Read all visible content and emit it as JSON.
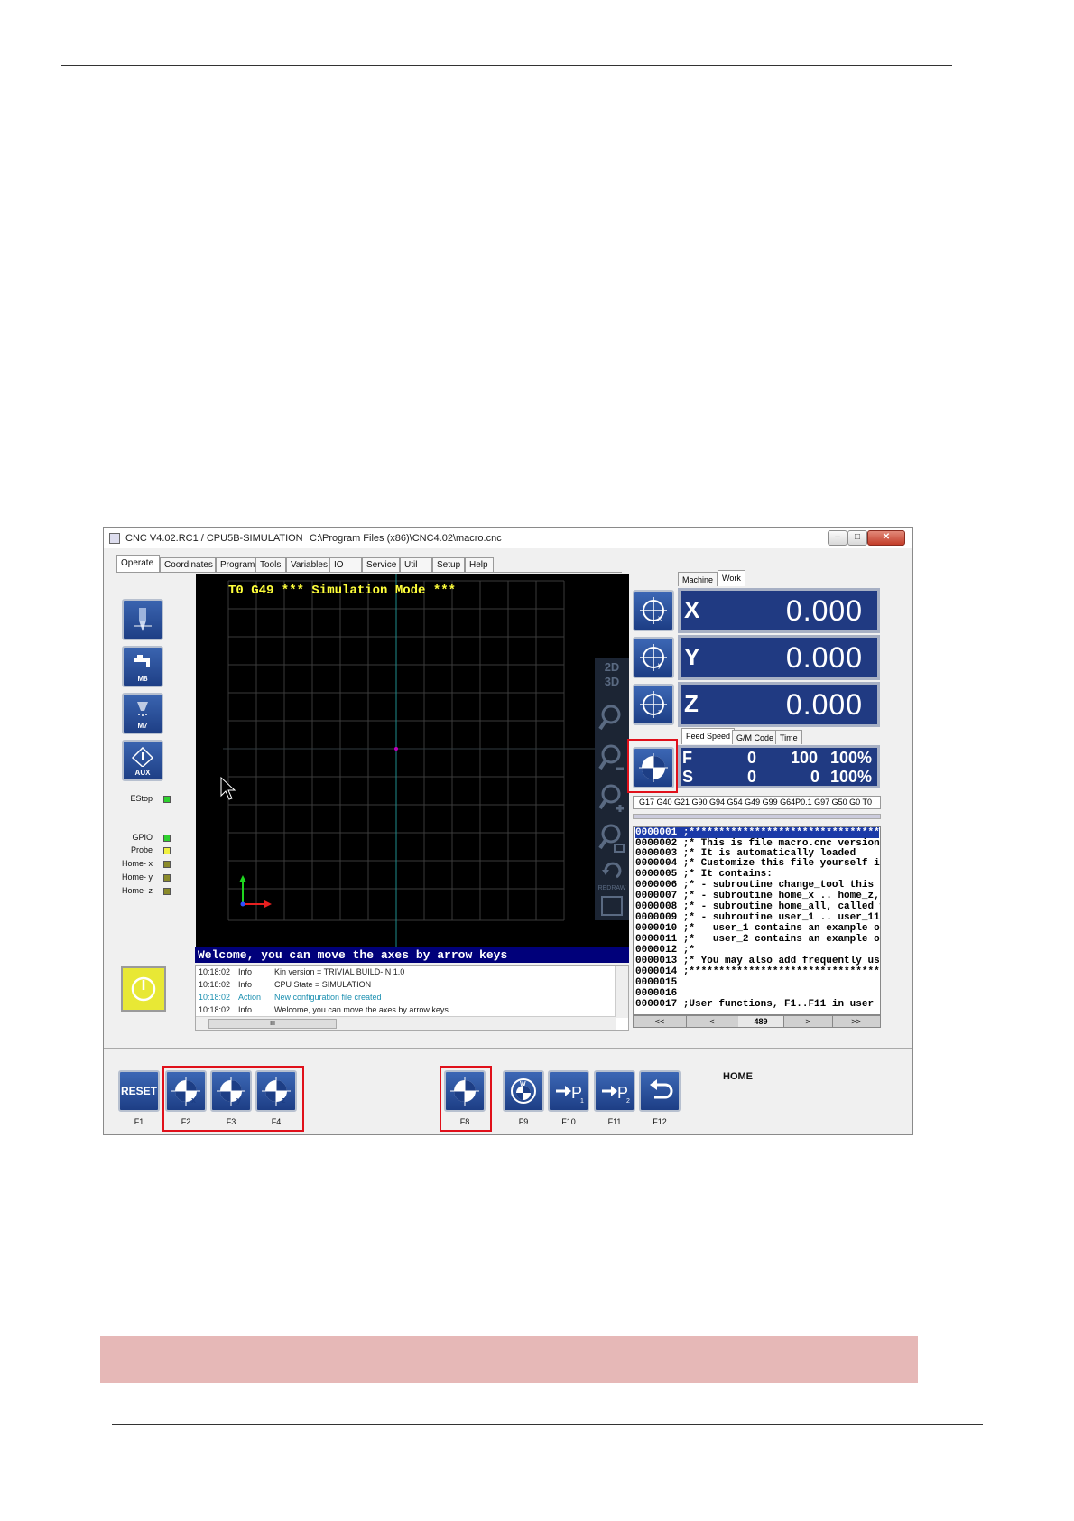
{
  "window": {
    "title": "CNC V4.02.RC1 / CPU5B-SIMULATION",
    "path": "C:\\Program Files (x86)\\CNC4.02\\macro.cnc",
    "min": "–",
    "max": "□",
    "close": "✕"
  },
  "tabs": [
    "Operate",
    "Coordinates",
    "Program",
    "Tools",
    "Variables",
    "IO",
    "Service",
    "Util",
    "Setup",
    "Help"
  ],
  "left_buttons": {
    "m8": "M8",
    "m7": "M7",
    "aux": "AUX"
  },
  "status": [
    {
      "label": "EStop",
      "color": "#2ed12e"
    },
    {
      "label": "GPIO",
      "color": "#2ed12e"
    },
    {
      "label": "Probe",
      "color": "#f0f040"
    },
    {
      "label": "Home- x",
      "color": "#8a8a2a"
    },
    {
      "label": "Home- y",
      "color": "#8a8a2a"
    },
    {
      "label": "Home- z",
      "color": "#8a8a2a"
    }
  ],
  "sim": {
    "header": "T0 G49 *** Simulation Mode ***",
    "tools": [
      "2D",
      "3D",
      "REDRAW"
    ]
  },
  "cmdline": "Welcome, you can move the axes by arrow keys",
  "log": [
    {
      "time": "10:18:02",
      "type": "Info",
      "msg": "Kin version = TRIVIAL BUILD-IN 1.0",
      "color": "#222222"
    },
    {
      "time": "10:18:02",
      "type": "Info",
      "msg": "CPU State = SIMULATION",
      "color": "#222222"
    },
    {
      "time": "10:18:02",
      "type": "Action",
      "msg": "New configuration file created",
      "color": "#1a8fb0"
    },
    {
      "time": "10:18:02",
      "type": "Info",
      "msg": "Welcome, you can move the axes by arrow keys",
      "color": "#222222"
    }
  ],
  "log_hscroll_glyph": "III",
  "coord_tabs": [
    "Machine",
    "Work"
  ],
  "dro": [
    {
      "axis": "X",
      "value": "0.000"
    },
    {
      "axis": "Y",
      "value": "0.000"
    },
    {
      "axis": "Z",
      "value": "0.000"
    }
  ],
  "info_tabs": [
    "Feed Speed",
    "G/M Code",
    "Time"
  ],
  "feed": {
    "label": "F",
    "actual": "0",
    "set": "100",
    "override": "100%"
  },
  "speed": {
    "label": "S",
    "actual": "0",
    "set": "0",
    "override": "100%"
  },
  "gcodes": "G17 G40 G21 G90 G94 G54 G49 G99 G64P0.1 G97 G50 G0 T0",
  "program": [
    {
      "ln": "0000001",
      "text": ";***************************************"
    },
    {
      "ln": "0000002",
      "text": ";* This is file macro.cnc version"
    },
    {
      "ln": "0000003",
      "text": ";* It is automatically loaded"
    },
    {
      "ln": "0000004",
      "text": ";* Customize this file yourself if"
    },
    {
      "ln": "0000005",
      "text": ";* It contains:"
    },
    {
      "ln": "0000006",
      "text": ";* - subroutine change_tool this"
    },
    {
      "ln": "0000007",
      "text": ";* - subroutine home_x .. home_z,"
    },
    {
      "ln": "0000008",
      "text": ";* - subroutine home_all, called w"
    },
    {
      "ln": "0000009",
      "text": ";* - subroutine user_1 .. user_11,"
    },
    {
      "ln": "0000010",
      "text": ";*   user_1 contains an example of"
    },
    {
      "ln": "0000011",
      "text": ";*   user_2 contains an example of"
    },
    {
      "ln": "0000012",
      "text": ";*"
    },
    {
      "ln": "0000013",
      "text": ";* You may also add frequently use"
    },
    {
      "ln": "0000014",
      "text": ";***************************************"
    },
    {
      "ln": "0000015",
      "text": ""
    },
    {
      "ln": "0000016",
      "text": ""
    },
    {
      "ln": "0000017",
      "text": ";User functions, F1..F11 in user m"
    }
  ],
  "prog_nav": [
    "<<",
    "<",
    "489",
    ">",
    ">>"
  ],
  "fkeys": {
    "reset_label": "RESET",
    "f1": "F1",
    "f2": "F2",
    "f3": "F3",
    "f4": "F4",
    "f8": "F8",
    "f9": "F9",
    "f10": "F10",
    "f11": "F11",
    "f12": "F12",
    "mode_label": "HOME"
  }
}
